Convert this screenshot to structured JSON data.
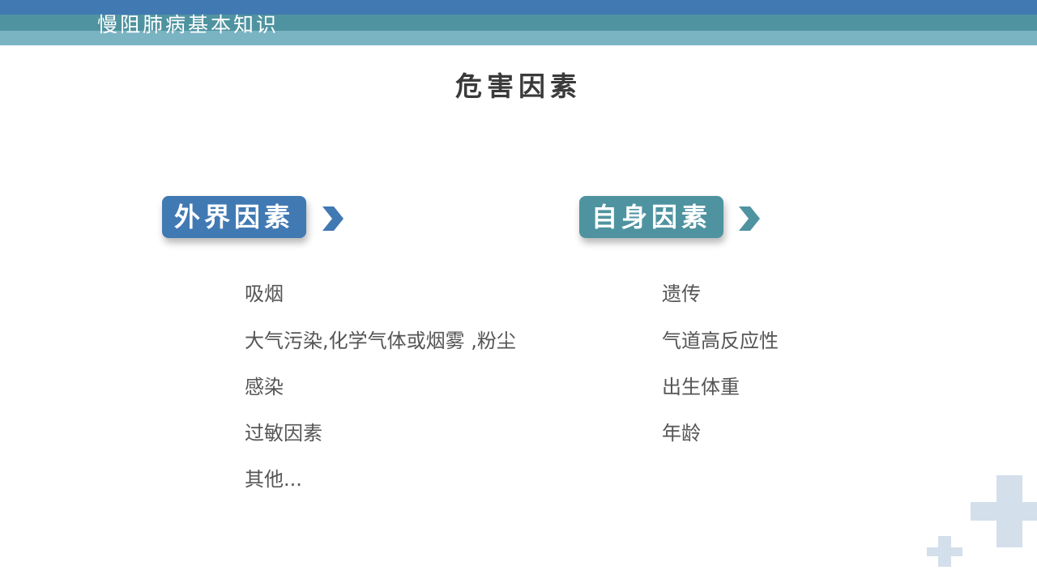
{
  "header": {
    "title": "慢阻肺病基本知识"
  },
  "slide": {
    "title": "危害因素"
  },
  "sections": [
    {
      "badge": "外界因素",
      "items": [
        "吸烟",
        "大气污染,化学气体或烟雾 ,粉尘",
        "感染",
        "过敏因素",
        "其他..."
      ]
    },
    {
      "badge": "自身因素",
      "items": [
        "遗传",
        "气道高反应性",
        "出生体重",
        "年龄"
      ]
    }
  ],
  "colors": {
    "band_top": "#4179b3",
    "band_mid": "#4f93a0",
    "band_bottom": "#7ab4c3",
    "badge_external": "#4179b3",
    "badge_internal": "#4f93a0",
    "text": "#555555",
    "title": "#3a3a3a",
    "cross_decoration": "#d3dfeb"
  },
  "icons": {
    "section_arrow": "chevron-right-icon",
    "decoration": "medical-cross-icon"
  }
}
